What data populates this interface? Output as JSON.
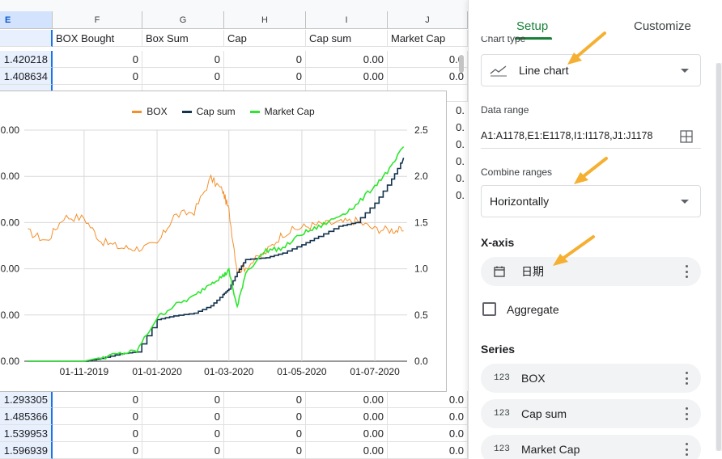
{
  "sheet": {
    "columns": [
      {
        "letter": "E"
      },
      {
        "letter": "F"
      },
      {
        "letter": "G"
      },
      {
        "letter": "H"
      },
      {
        "letter": "I"
      },
      {
        "letter": "J"
      }
    ],
    "header_row": [
      "",
      "BOX Bought",
      "Box Sum",
      "Cap",
      "Cap sum",
      "Market Cap"
    ],
    "top_rows": [
      [
        "1.420218",
        "0",
        "0",
        "0",
        "0.00",
        "0.0"
      ],
      [
        "1.408634",
        "0",
        "0",
        "0",
        "0.00",
        "0.0"
      ]
    ],
    "bottom_rows": [
      [
        "1.293305",
        "0",
        "0",
        "0",
        "0.00",
        "0.0"
      ],
      [
        "1.485366",
        "0",
        "0",
        "0",
        "0.00",
        "0.0"
      ],
      [
        "1.539953",
        "0",
        "0",
        "0",
        "0.00",
        "0.0"
      ],
      [
        "1.596939",
        "0",
        "0",
        "0",
        "0.00",
        "0.0"
      ]
    ],
    "side_values": [
      "0.",
      "0.",
      "0.",
      "0.",
      "0.",
      "0."
    ]
  },
  "chart_data": {
    "type": "line",
    "legend": [
      "BOX",
      "Cap sum",
      "Market Cap"
    ],
    "legend_position": "top",
    "colors": {
      "BOX": "#f4902a",
      "Cap sum": "#14334d",
      "Market Cap": "#2ee62e"
    },
    "x_tick_labels": [
      "01-11-2019",
      "01-01-2020",
      "01-03-2020",
      "01-05-2020",
      "01-07-2020"
    ],
    "x": [
      "2019-09-15",
      "2019-10-01",
      "2019-10-15",
      "2019-11-01",
      "2019-11-15",
      "2019-12-01",
      "2019-12-15",
      "2020-01-01",
      "2020-01-15",
      "2020-02-01",
      "2020-02-15",
      "2020-02-25",
      "2020-03-01",
      "2020-03-08",
      "2020-03-15",
      "2020-04-01",
      "2020-04-15",
      "2020-05-01",
      "2020-05-15",
      "2020-06-01",
      "2020-06-15",
      "2020-07-01",
      "2020-07-15",
      "2020-07-25"
    ],
    "left_axis": {
      "tick_labels": [
        "0.00",
        "0.00",
        "0.00",
        "0.00",
        "0.00",
        "0.00"
      ],
      "series": [
        "BOX"
      ]
    },
    "right_axis": {
      "tick_labels": [
        "0.0",
        "0.5",
        "1.0",
        "1.5",
        "2.0",
        "2.5"
      ],
      "range": [
        0,
        2.5
      ],
      "series": [
        "Cap sum",
        "Market Cap"
      ]
    },
    "series": [
      {
        "name": "BOX",
        "axis": "left",
        "values": [
          1.4,
          1.3,
          1.56,
          1.55,
          1.3,
          1.23,
          1.22,
          1.26,
          1.57,
          1.62,
          1.98,
          1.84,
          1.63,
          0.98,
          1.02,
          1.18,
          1.38,
          1.45,
          1.48,
          1.5,
          1.52,
          1.43,
          1.42,
          1.41
        ]
      },
      {
        "name": "Cap sum",
        "axis": "right",
        "values": [
          0,
          0,
          0,
          0,
          0.03,
          0.08,
          0.1,
          0.45,
          0.49,
          0.52,
          0.6,
          0.72,
          0.78,
          0.96,
          1.1,
          1.12,
          1.17,
          1.26,
          1.35,
          1.46,
          1.5,
          1.71,
          1.97,
          2.2
        ]
      },
      {
        "name": "Market Cap",
        "axis": "right",
        "values": [
          0,
          0,
          0,
          0,
          0.04,
          0.08,
          0.11,
          0.47,
          0.6,
          0.7,
          0.85,
          0.92,
          0.98,
          0.58,
          0.96,
          1.2,
          1.22,
          1.38,
          1.45,
          1.57,
          1.68,
          1.9,
          2.1,
          2.32
        ]
      }
    ]
  },
  "panel": {
    "tabs": {
      "setup": "Setup",
      "customize": "Customize"
    },
    "chart_type_label": "Chart type",
    "chart_type_value": "Line chart",
    "data_range_label": "Data range",
    "data_range_value": "A1:A1178,E1:E1178,I1:I1178,J1:J1178",
    "combine_label": "Combine ranges",
    "combine_value": "Horizontally",
    "xaxis_section": "X-axis",
    "xaxis_value": "日期",
    "aggregate_label": "Aggregate",
    "series_section": "Series",
    "series_items": [
      "BOX",
      "Cap sum",
      "Market Cap"
    ],
    "series_icon_text": "123",
    "arrow_color": "#f5b032"
  }
}
